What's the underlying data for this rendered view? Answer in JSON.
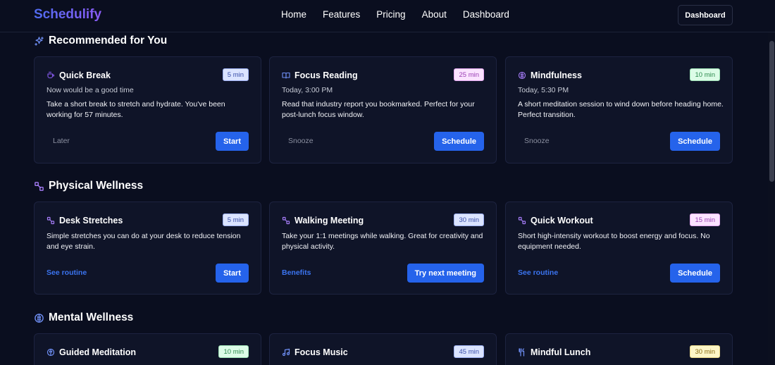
{
  "nav": {
    "brand": "Schedulify",
    "links": [
      "Home",
      "Features",
      "Pricing",
      "About",
      "Dashboard"
    ],
    "button": "Dashboard"
  },
  "sections": [
    {
      "title": "Recommended for You",
      "icon": "sparkle-icon",
      "cards": [
        {
          "icon": "coffee-icon",
          "title": "Quick Break",
          "badge": "5 min",
          "badge_color": "blue",
          "sub": "Now would be a good time",
          "desc": "Take a short break to stretch and hydrate. You've been working for 57 minutes.",
          "secondary": "Later",
          "primary": "Start"
        },
        {
          "icon": "book-icon",
          "title": "Focus Reading",
          "badge": "25 min",
          "badge_color": "pink",
          "sub": "Today, 3:00 PM",
          "desc": "Read that industry report you bookmarked. Perfect for your post-lunch focus window.",
          "secondary": "Snooze",
          "primary": "Schedule"
        },
        {
          "icon": "brain-icon",
          "title": "Mindfulness",
          "badge": "10 min",
          "badge_color": "green",
          "sub": "Today, 5:30 PM",
          "desc": "A short meditation session to wind down before heading home. Perfect transition.",
          "secondary": "Snooze",
          "primary": "Schedule"
        }
      ]
    },
    {
      "title": "Physical Wellness",
      "icon": "dumbbell-icon",
      "cards": [
        {
          "icon": "dumbbell-icon",
          "title": "Desk Stretches",
          "badge": "5 min",
          "badge_color": "blue",
          "desc": "Simple stretches you can do at your desk to reduce tension and eye strain.",
          "link": "See routine",
          "primary": "Start"
        },
        {
          "icon": "dumbbell-icon",
          "title": "Walking Meeting",
          "badge": "30 min",
          "badge_color": "blue",
          "desc": "Take your 1:1 meetings while walking. Great for creativity and physical activity.",
          "link": "Benefits",
          "primary": "Try next meeting"
        },
        {
          "icon": "dumbbell-icon",
          "title": "Quick Workout",
          "badge": "15 min",
          "badge_color": "pink",
          "desc": "Short high-intensity workout to boost energy and focus. No equipment needed.",
          "link": "See routine",
          "primary": "Schedule"
        }
      ]
    },
    {
      "title": "Mental Wellness",
      "icon": "brain-icon",
      "cards": [
        {
          "icon": "brain-icon",
          "title": "Guided Meditation",
          "badge": "10 min",
          "badge_color": "green"
        },
        {
          "icon": "music-icon",
          "title": "Focus Music",
          "badge": "45 min",
          "badge_color": "blue"
        },
        {
          "icon": "utensils-icon",
          "title": "Mindful Lunch",
          "badge": "30 min",
          "badge_color": "yellow"
        }
      ]
    }
  ],
  "colors": {
    "background": "#0a0e1f",
    "card": "#0f1428",
    "primary": "#2563eb",
    "accent": "#8b5cf6",
    "link": "#3b74f0"
  }
}
